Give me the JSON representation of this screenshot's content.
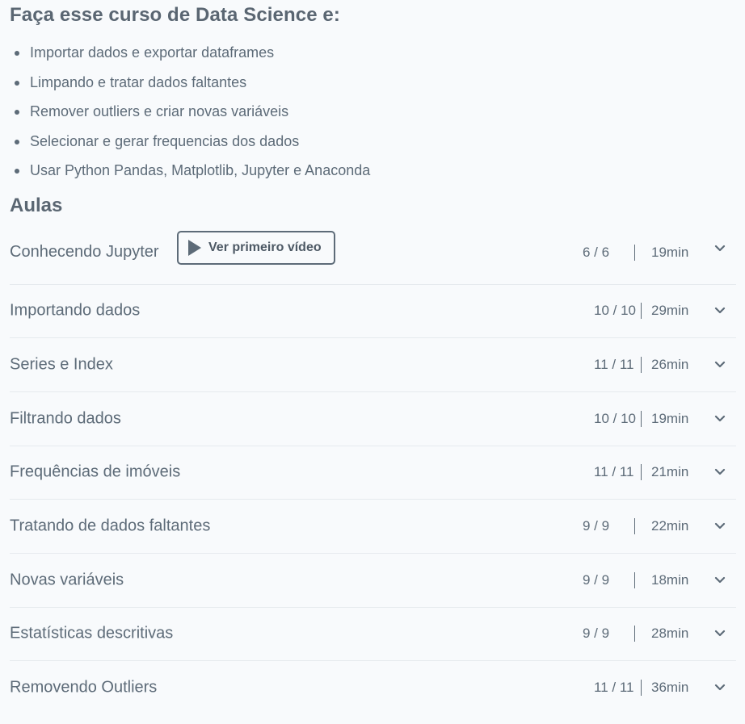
{
  "course": {
    "heading": "Faça esse curso de Data Science e:",
    "bullets": [
      "Importar dados e exportar dataframes",
      "Limpando e tratar dados faltantes",
      "Remover outliers e criar novas variáveis",
      "Selecionar e gerar frequencias dos dados",
      "Usar Python Pandas, Matplotlib, Jupyter e Anaconda"
    ]
  },
  "lessons_heading": "Aulas",
  "first_video_button": "Ver primeiro vídeo",
  "icons": {
    "play": "play-icon",
    "expand": "chevron-down-icon"
  },
  "lessons": [
    {
      "title": "Conhecendo Jupyter",
      "progress": "6 / 6",
      "duration": "19min"
    },
    {
      "title": "Importando dados",
      "progress": "10 / 10",
      "duration": "29min"
    },
    {
      "title": "Series e Index",
      "progress": "11 / 11",
      "duration": "26min"
    },
    {
      "title": "Filtrando dados",
      "progress": "10 / 10",
      "duration": "19min"
    },
    {
      "title": "Frequências de imóveis",
      "progress": "11 / 11",
      "duration": "21min"
    },
    {
      "title": "Tratando de dados faltantes",
      "progress": "9 / 9",
      "duration": "22min"
    },
    {
      "title": "Novas variáveis",
      "progress": "9 / 9",
      "duration": "18min"
    },
    {
      "title": "Estatísticas descritivas",
      "progress": "9 / 9",
      "duration": "28min"
    },
    {
      "title": "Removendo Outliers",
      "progress": "11 / 11",
      "duration": "36min"
    }
  ]
}
